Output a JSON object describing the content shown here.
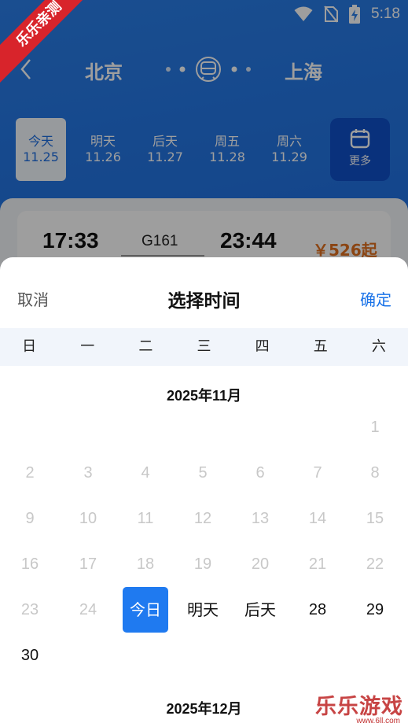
{
  "status": {
    "time": "5:18"
  },
  "ribbon": "乐乐亲测",
  "route": {
    "from": "北京",
    "to": "上海"
  },
  "dates": [
    {
      "day": "今天",
      "date": "11.25",
      "active": true
    },
    {
      "day": "明天",
      "date": "11.26",
      "active": false
    },
    {
      "day": "后天",
      "date": "11.27",
      "active": false
    },
    {
      "day": "周五",
      "date": "11.28",
      "active": false
    },
    {
      "day": "周六",
      "date": "11.29",
      "active": false
    }
  ],
  "more_label": "更多",
  "train": {
    "depart": "17:33",
    "number": "G161",
    "arrive": "23:44",
    "price": "￥526起"
  },
  "picker": {
    "cancel": "取消",
    "title": "选择时间",
    "confirm": "确定",
    "weekdays": [
      "日",
      "一",
      "二",
      "三",
      "四",
      "五",
      "六"
    ],
    "month1": "2025年11月",
    "month2": "2025年12月",
    "days": [
      {
        "text": "1",
        "state": "past",
        "row": 0,
        "col": 6
      },
      {
        "text": "2",
        "state": "past",
        "row": 1,
        "col": 0
      },
      {
        "text": "3",
        "state": "past",
        "row": 1,
        "col": 1
      },
      {
        "text": "4",
        "state": "past",
        "row": 1,
        "col": 2
      },
      {
        "text": "5",
        "state": "past",
        "row": 1,
        "col": 3
      },
      {
        "text": "6",
        "state": "past",
        "row": 1,
        "col": 4
      },
      {
        "text": "7",
        "state": "past",
        "row": 1,
        "col": 5
      },
      {
        "text": "8",
        "state": "past",
        "row": 1,
        "col": 6
      },
      {
        "text": "9",
        "state": "past",
        "row": 2,
        "col": 0
      },
      {
        "text": "10",
        "state": "past",
        "row": 2,
        "col": 1
      },
      {
        "text": "11",
        "state": "past",
        "row": 2,
        "col": 2
      },
      {
        "text": "12",
        "state": "past",
        "row": 2,
        "col": 3
      },
      {
        "text": "13",
        "state": "past",
        "row": 2,
        "col": 4
      },
      {
        "text": "14",
        "state": "past",
        "row": 2,
        "col": 5
      },
      {
        "text": "15",
        "state": "past",
        "row": 2,
        "col": 6
      },
      {
        "text": "16",
        "state": "past",
        "row": 3,
        "col": 0
      },
      {
        "text": "17",
        "state": "past",
        "row": 3,
        "col": 1
      },
      {
        "text": "18",
        "state": "past",
        "row": 3,
        "col": 2
      },
      {
        "text": "19",
        "state": "past",
        "row": 3,
        "col": 3
      },
      {
        "text": "20",
        "state": "past",
        "row": 3,
        "col": 4
      },
      {
        "text": "21",
        "state": "past",
        "row": 3,
        "col": 5
      },
      {
        "text": "22",
        "state": "past",
        "row": 3,
        "col": 6
      },
      {
        "text": "23",
        "state": "past",
        "row": 4,
        "col": 0
      },
      {
        "text": "24",
        "state": "past",
        "row": 4,
        "col": 1
      },
      {
        "text": "今日",
        "state": "selected",
        "row": 4,
        "col": 2
      },
      {
        "text": "明天",
        "state": "future",
        "row": 4,
        "col": 3
      },
      {
        "text": "后天",
        "state": "future",
        "row": 4,
        "col": 4
      },
      {
        "text": "28",
        "state": "future",
        "row": 4,
        "col": 5
      },
      {
        "text": "29",
        "state": "future",
        "row": 4,
        "col": 6
      },
      {
        "text": "30",
        "state": "future",
        "row": 5,
        "col": 0
      }
    ]
  },
  "watermark": {
    "text": "乐乐游戏",
    "url": "www.6ll.com"
  },
  "colors": {
    "accent": "#1f7af0",
    "header_blue": "#1f6fe0",
    "price_orange": "#e07020"
  }
}
